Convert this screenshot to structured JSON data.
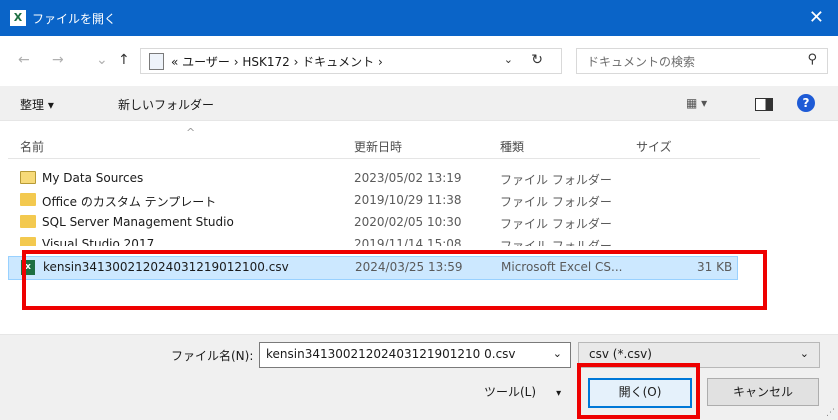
{
  "window": {
    "title": "ファイルを開く",
    "app_badge": "X",
    "close_glyph": "✕"
  },
  "nav": {
    "back": "←",
    "forward": "→",
    "recent": "⌄",
    "up": "↑"
  },
  "address": {
    "breadcrumb": "« ユーザー  ›  HSK172  ›  ドキュメント  ›",
    "dropdown": "⌄",
    "refresh": "↻"
  },
  "search": {
    "placeholder": "ドキュメントの検索",
    "icon": "⚲"
  },
  "toolbar": {
    "organize": "整理 ▾",
    "new_folder": "新しいフォルダー",
    "view_glyph": "▦ ▾",
    "help": "?"
  },
  "columns": [
    "名前",
    "更新日時",
    "種類",
    "サイズ"
  ],
  "files": [
    {
      "name": "My Data Sources",
      "date": "2023/05/02 13:19",
      "type": "ファイル フォルダー",
      "size": ""
    },
    {
      "name": "Office のカスタム テンプレート",
      "date": "2019/10/29 11:38",
      "type": "ファイル フォルダー",
      "size": ""
    },
    {
      "name": "SQL Server Management Studio",
      "date": "2020/02/05 10:30",
      "type": "ファイル フォルダー",
      "size": ""
    },
    {
      "name": "Visual Studio 2017",
      "date": "2019/11/14 15:08",
      "type": "ファイル フォルダー",
      "size": ""
    },
    {
      "name": "kensin3413002120240312190121​00.csv",
      "date": "2024/03/25 13:59",
      "type": "Microsoft Excel CS...",
      "size": "31 KB"
    }
  ],
  "bottom": {
    "filename_label": "ファイル名(N):",
    "filename_value": "kensin34130021202403121901210 0.csv",
    "filetype_value": "csv (*.csv)",
    "tools_label": "ツール(L)",
    "tools_dd": "▾",
    "open": "開く(O)",
    "cancel": "キャンセル"
  },
  "xl_badge": "x",
  "highlight_color": "#e00000"
}
